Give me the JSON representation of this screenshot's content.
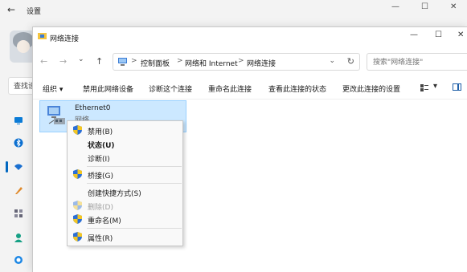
{
  "settings": {
    "back": "←",
    "title": "设置",
    "search_label": "查找设置"
  },
  "window": {
    "title": "网络连接",
    "controls": {
      "minimize": "—",
      "maximize": "☐",
      "close": "✕"
    }
  },
  "nav": {
    "back": "←",
    "forward": "→",
    "dropdown": "⌄",
    "up": "↑"
  },
  "address": {
    "crumbs": [
      "控制面板",
      "网络和 Internet",
      "网络连接"
    ],
    "separator": ">",
    "dropdown": "⌄",
    "refresh": "↻"
  },
  "search": {
    "placeholder": "搜索\"网络连接\""
  },
  "commands": {
    "organize": "组织 ▾",
    "disable": "禁用此网络设备",
    "diagnose": "诊断这个连接",
    "rename": "重命名此连接",
    "status": "查看此连接的状态",
    "settings": "更改此连接的设置",
    "view": "▾"
  },
  "item": {
    "name": "Ethernet0",
    "sub": "网络"
  },
  "menu": {
    "disable": "禁用(B)",
    "status": "状态(U)",
    "diagnose": "诊断(I)",
    "bridge": "桥接(G)",
    "shortcut": "创建快捷方式(S)",
    "delete": "删除(D)",
    "rename": "重命名(M)",
    "properties": "属性(R)"
  },
  "colors": {
    "accent": "#0067c0",
    "selection": "#cce8ff",
    "shield_blue": "#2b6fd6",
    "shield_yellow": "#f3c623"
  }
}
